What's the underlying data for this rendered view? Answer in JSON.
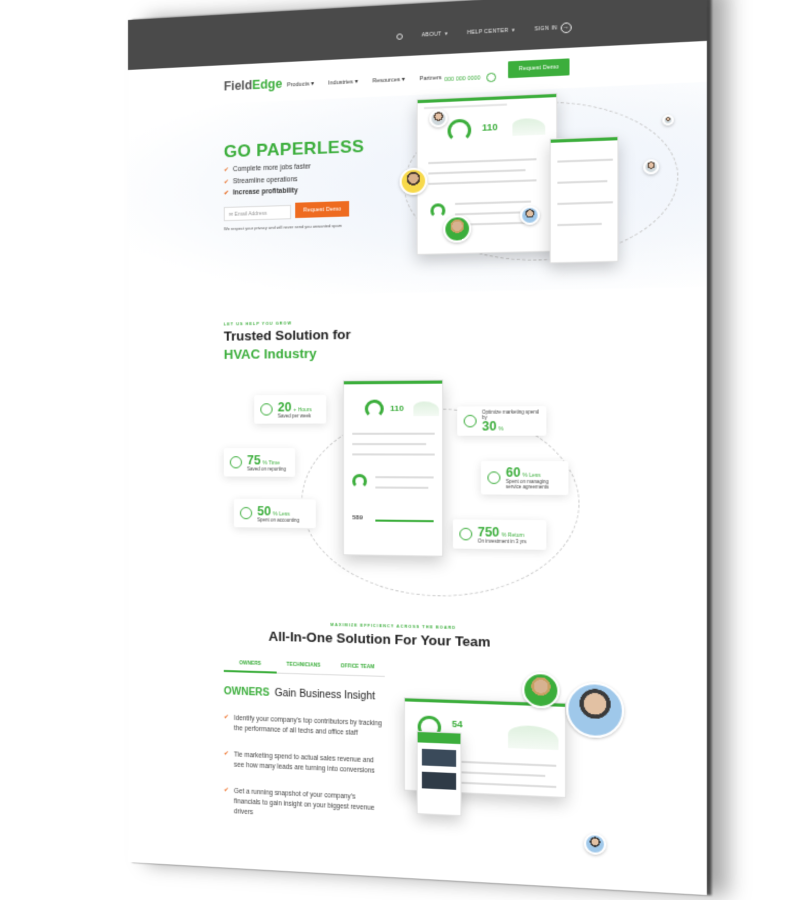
{
  "topbar": {
    "about": "ABOUT",
    "help_center": "HELP CENTER",
    "sign_in": "SIGN IN"
  },
  "nav": {
    "logo_main": "Field",
    "logo_accent": "Edge",
    "links": [
      "Products",
      "Industries",
      "Resources",
      "Partners"
    ],
    "phone": "000 000 0000",
    "cta": "Request Demo"
  },
  "hero": {
    "title": "GO PAPERLESS",
    "bullets": [
      "Complete more jobs faster",
      "Streamline operations",
      "Increase profitability"
    ],
    "email_placeholder": "Email Address",
    "cta": "Request Demo",
    "privacy": "We respect your privacy and will never send you unwanted spam",
    "dash_number": "110"
  },
  "trusted": {
    "eyebrow": "LET US HELP YOU GROW",
    "title_line1": "Trusted Solution for",
    "title_line2": "HVAC Industry",
    "dash_number": "110",
    "dash_small": "589",
    "stats": [
      {
        "value": "20",
        "unit": "+ Hours",
        "text": "Saved per week"
      },
      {
        "value": "75",
        "unit": "% Time",
        "text": "Saved on reporting"
      },
      {
        "value": "50",
        "unit": "% Less",
        "text": "Spent on accounting"
      },
      {
        "value": "30",
        "unit": "%",
        "text": "Optimize marketing spend by"
      },
      {
        "value": "60",
        "unit": "% Less",
        "text": "Spent on managing service agreements"
      },
      {
        "value": "750",
        "unit": "% Return",
        "text": "On investment in 3 yrs"
      }
    ]
  },
  "team": {
    "eyebrow": "MAXIMIZE EFFICIENCY ACROSS THE BOARD",
    "title": "All-In-One Solution For Your Team",
    "tabs": [
      "OWNERS",
      "TECHNICIANS",
      "OFFICE TEAM"
    ],
    "heading_accent": "OWNERS",
    "heading_rest": "Gain Business Insight",
    "features": [
      "Identify your company's top contributors by tracking the performance of all techs and office staff",
      "Tie marketing spend to actual sales revenue and see how many leads are turning into conversions",
      "Get a running snapshot of your company's financials to gain insight on your biggest revenue drivers"
    ],
    "dash_number": "54"
  },
  "colors": {
    "brand_green": "#3cae3c",
    "cta_orange": "#ee6b20",
    "topbar": "#4a4a4a"
  }
}
